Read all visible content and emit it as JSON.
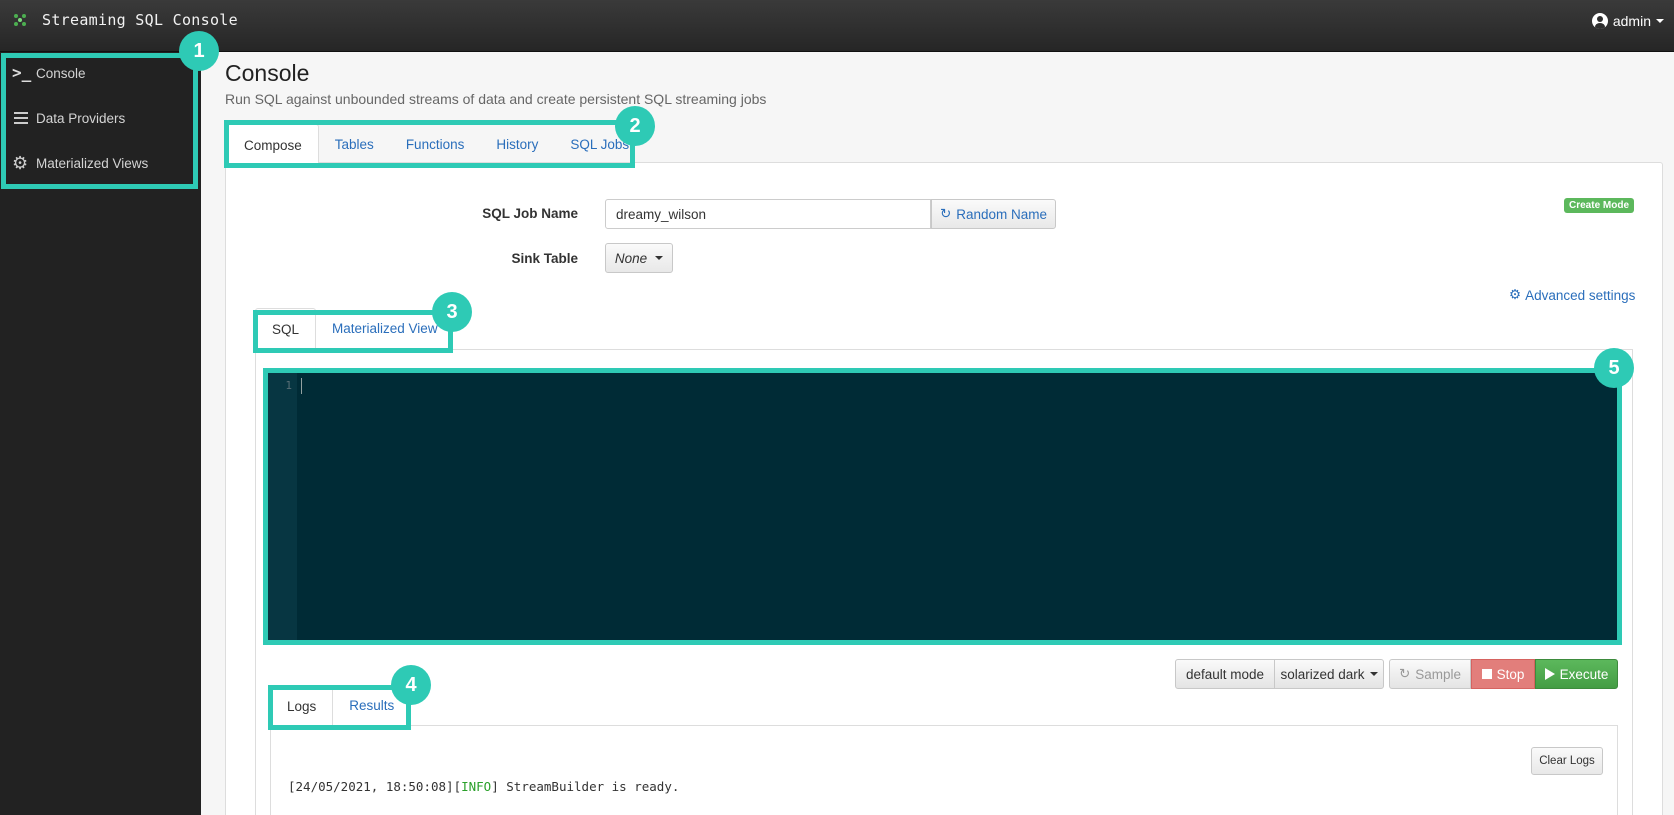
{
  "app": {
    "title": "Streaming SQL Console",
    "user": "admin"
  },
  "sidebar": {
    "items": [
      {
        "label": "Console",
        "icon": "terminal-prompt-icon"
      },
      {
        "label": "Data Providers",
        "icon": "list-bars-icon"
      },
      {
        "label": "Materialized Views",
        "icon": "gear-icon"
      }
    ]
  },
  "page": {
    "title": "Console",
    "subtitle": "Run SQL against unbounded streams of data and create persistent SQL streaming jobs"
  },
  "main_tabs": [
    "Compose",
    "Tables",
    "Functions",
    "History",
    "SQL Jobs"
  ],
  "form": {
    "job_name_label": "SQL Job Name",
    "job_name_value": "dreamy_wilson",
    "random_name_label": "Random Name",
    "sink_table_label": "Sink Table",
    "sink_table_value": "None",
    "mode_badge": "Create Mode",
    "advanced_settings": "Advanced settings"
  },
  "editor_tabs": [
    "SQL",
    "Materialized View"
  ],
  "editor": {
    "line_numbers": [
      "1"
    ],
    "theme": "solarized dark"
  },
  "toolbar": {
    "mode": "default mode",
    "theme": "solarized dark",
    "sample": "Sample",
    "stop": "Stop",
    "execute": "Execute"
  },
  "output_tabs": [
    "Logs",
    "Results"
  ],
  "logs": {
    "clear_label": "Clear Logs",
    "entries": [
      {
        "timestamp": "[24/05/2021, 18:50:08]",
        "level": "INFO",
        "message": "StreamBuilder is ready."
      }
    ]
  },
  "callouts": [
    "1",
    "2",
    "3",
    "4",
    "5"
  ],
  "colors": {
    "highlight": "#2ecab5",
    "editor_bg": "#002b36",
    "execute": "#5cb85c",
    "stop": "#d9534f",
    "link": "#2a6ebb"
  }
}
